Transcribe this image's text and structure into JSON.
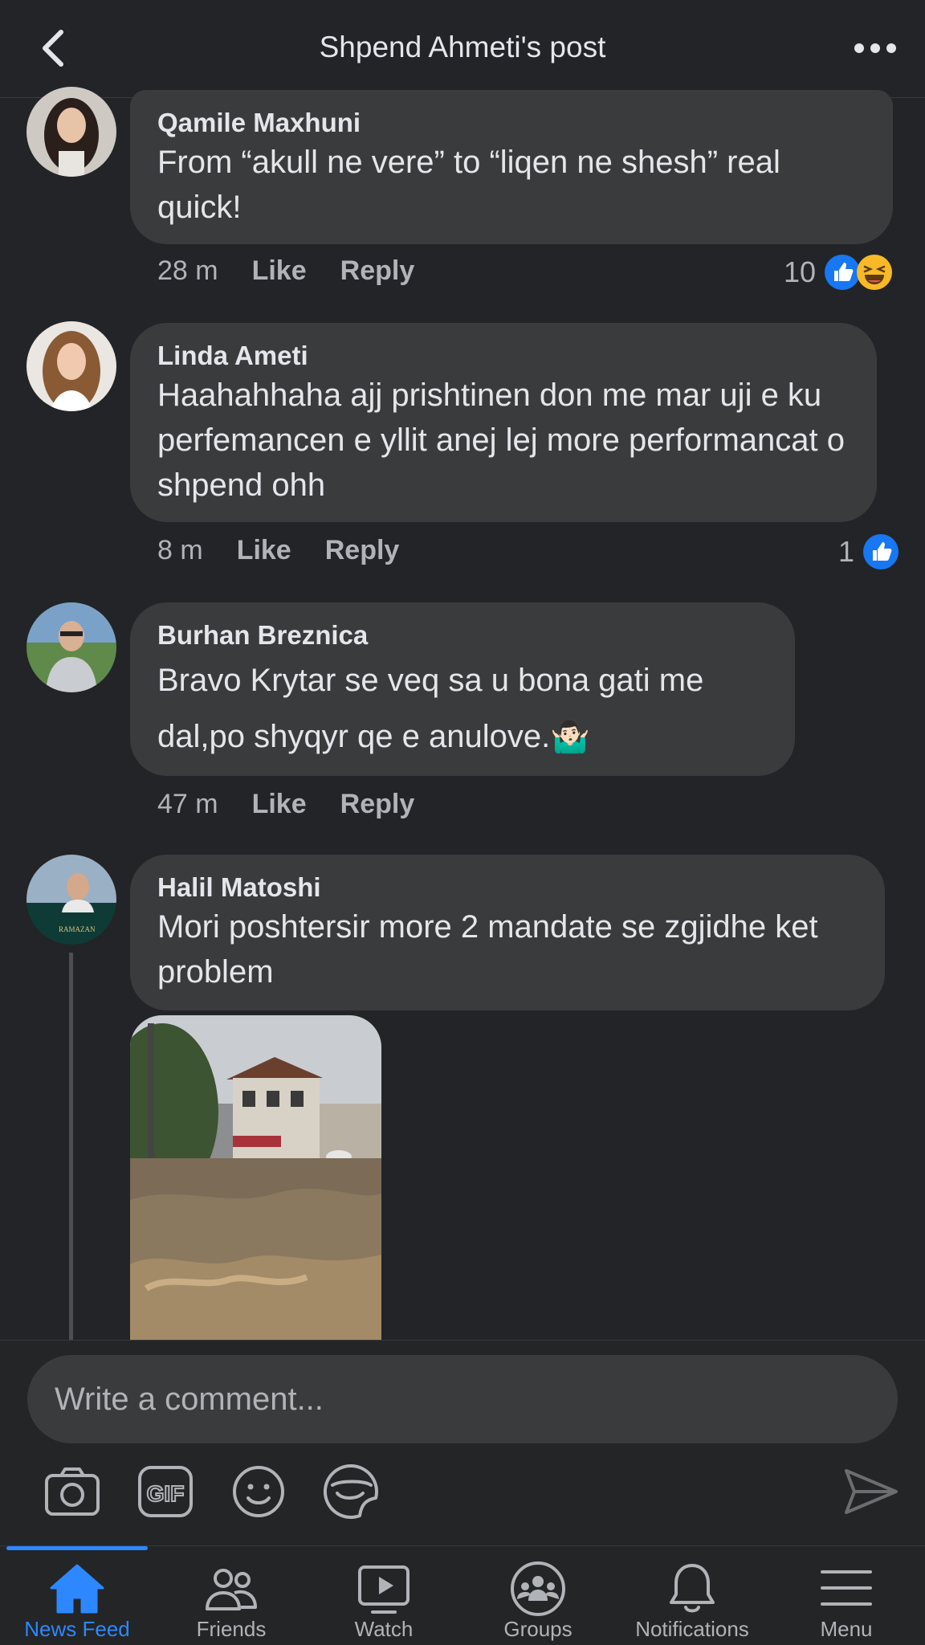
{
  "header": {
    "title": "Shpend Ahmeti's post",
    "back_icon": "chevron-left-icon",
    "more_icon": "more-horizontal-icon"
  },
  "comments": [
    {
      "author": "Qamile Maxhuni",
      "text": "From “akull ne vere” to “liqen ne shesh” real quick!",
      "time": "28 m",
      "like": "Like",
      "reply": "Reply",
      "reaction_count": "10",
      "reactions": [
        "like-reaction-icon",
        "haha-reaction-icon"
      ]
    },
    {
      "author": "Linda Ameti",
      "text": "Haahahhaha ajj prishtinen don me mar uji e ku perfemancen e yllit anej lej more performancat o shpend ohh",
      "time": "8 m",
      "like": "Like",
      "reply": "Reply",
      "reaction_count": "1",
      "reactions": [
        "like-reaction-icon"
      ]
    },
    {
      "author": "Burhan Breznica",
      "text": "Bravo Krytar se veq sa u bona gati me dal,po shyqyr qe e anulove.🤷🏻‍♂️",
      "time": "47 m",
      "like": "Like",
      "reply": "Reply"
    },
    {
      "author": "Halil Matoshi",
      "text": "Mori poshtersir more  2 mandate se zgjidhe ket problem",
      "media_icon": "flood-video-thumbnail"
    }
  ],
  "composer": {
    "placeholder": "Write a comment...",
    "tools": [
      "camera-icon",
      "gif-icon",
      "emoji-icon",
      "sticker-icon"
    ],
    "send_icon": "send-icon"
  },
  "nav": {
    "items": [
      {
        "label": "News Feed",
        "icon": "home-icon",
        "active": true
      },
      {
        "label": "Friends",
        "icon": "friends-icon"
      },
      {
        "label": "Watch",
        "icon": "watch-icon"
      },
      {
        "label": "Groups",
        "icon": "groups-icon"
      },
      {
        "label": "Notifications",
        "icon": "bell-icon"
      },
      {
        "label": "Menu",
        "icon": "menu-icon"
      }
    ],
    "accent_color": "#2d88ff"
  },
  "colors": {
    "background": "#232427",
    "bubble": "#3a3b3c",
    "secondary_text": "#b0b3b8",
    "like_blue": "#1877f2",
    "haha_yellow": "#f7b928"
  }
}
